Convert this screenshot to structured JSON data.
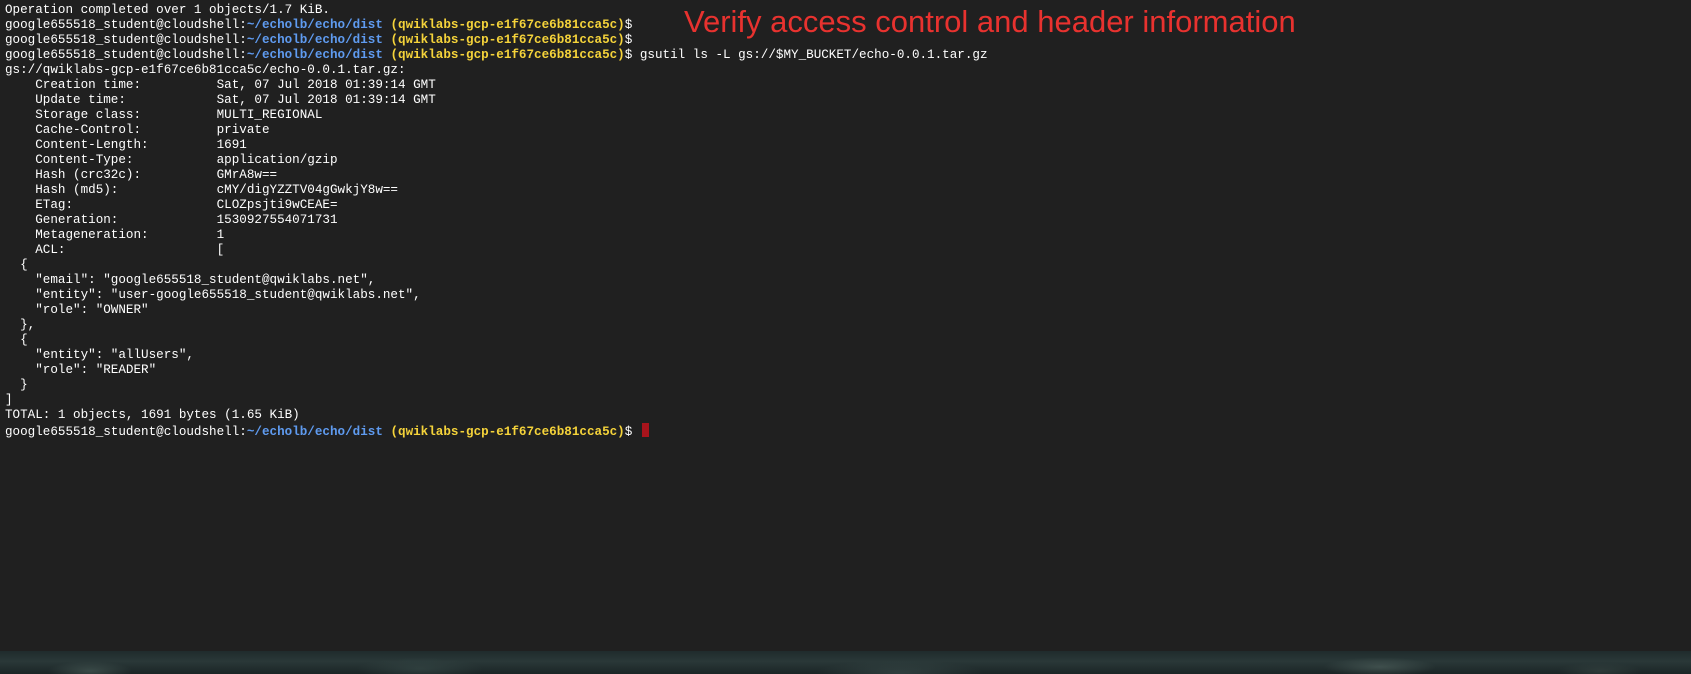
{
  "annotation": "Verify access control and header information",
  "terminal": {
    "prompt_user": "google655518_student@cloudshell:",
    "prompt_path": "~/echolb/echo/dist",
    "prompt_project": "(qwiklabs-gcp-e1f67ce6b81cca5c)",
    "prompt_symbol": "$",
    "colors": {
      "background": "#202020",
      "text": "#ffffff",
      "path": "#5f9bf0",
      "project": "#f5d33a",
      "cursor": "#a8141c",
      "annotation": "#e8322f"
    },
    "lines": [
      {
        "type": "output",
        "text": "Operation completed over 1 objects/1.7 KiB."
      },
      {
        "type": "prompt",
        "command": ""
      },
      {
        "type": "prompt",
        "command": ""
      },
      {
        "type": "prompt",
        "command": " gsutil ls -L gs://$MY_BUCKET/echo-0.0.1.tar.gz"
      },
      {
        "type": "output",
        "text": "gs://qwiklabs-gcp-e1f67ce6b81cca5c/echo-0.0.1.tar.gz:"
      },
      {
        "type": "output",
        "text": "    Creation time:          Sat, 07 Jul 2018 01:39:14 GMT"
      },
      {
        "type": "output",
        "text": "    Update time:            Sat, 07 Jul 2018 01:39:14 GMT"
      },
      {
        "type": "output",
        "text": "    Storage class:          MULTI_REGIONAL"
      },
      {
        "type": "output",
        "text": "    Cache-Control:          private"
      },
      {
        "type": "output",
        "text": "    Content-Length:         1691"
      },
      {
        "type": "output",
        "text": "    Content-Type:           application/gzip"
      },
      {
        "type": "output",
        "text": "    Hash (crc32c):          GMrA8w=="
      },
      {
        "type": "output",
        "text": "    Hash (md5):             cMY/digYZZTV04gGwkjY8w=="
      },
      {
        "type": "output",
        "text": "    ETag:                   CLOZpsjti9wCEAE="
      },
      {
        "type": "output",
        "text": "    Generation:             1530927554071731"
      },
      {
        "type": "output",
        "text": "    Metageneration:         1"
      },
      {
        "type": "output",
        "text": "    ACL:                    ["
      },
      {
        "type": "output",
        "text": "  {"
      },
      {
        "type": "output",
        "text": "    \"email\": \"google655518_student@qwiklabs.net\","
      },
      {
        "type": "output",
        "text": "    \"entity\": \"user-google655518_student@qwiklabs.net\","
      },
      {
        "type": "output",
        "text": "    \"role\": \"OWNER\""
      },
      {
        "type": "output",
        "text": "  },"
      },
      {
        "type": "output",
        "text": "  {"
      },
      {
        "type": "output",
        "text": "    \"entity\": \"allUsers\","
      },
      {
        "type": "output",
        "text": "    \"role\": \"READER\""
      },
      {
        "type": "output",
        "text": "  }"
      },
      {
        "type": "output",
        "text": "]"
      },
      {
        "type": "output",
        "text": "TOTAL: 1 objects, 1691 bytes (1.65 KiB)"
      },
      {
        "type": "prompt",
        "command": " ",
        "cursor": true
      }
    ]
  }
}
